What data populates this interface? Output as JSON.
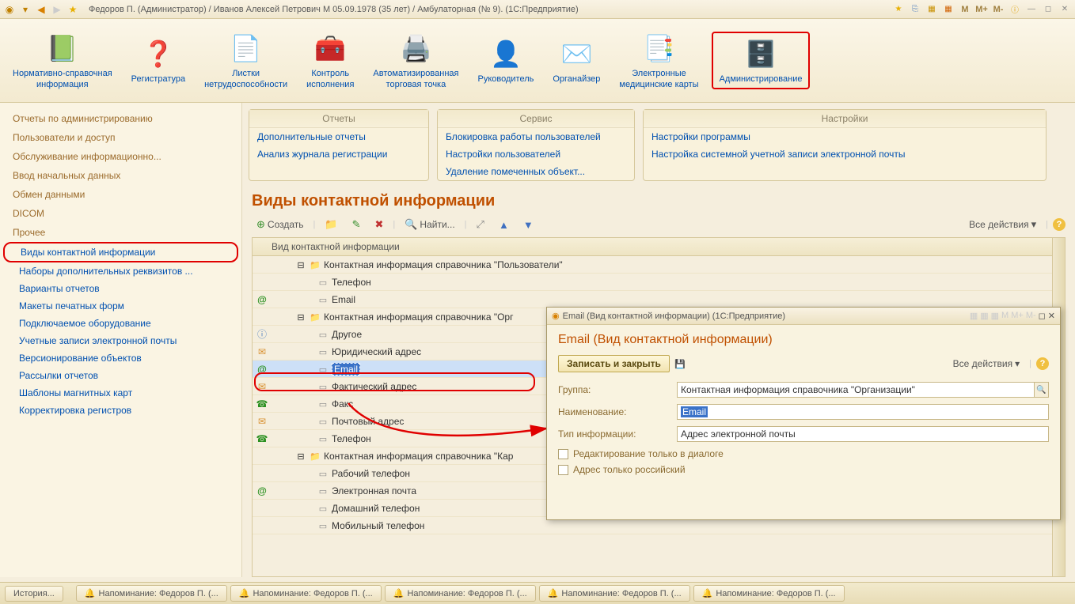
{
  "window": {
    "title": "Федоров П. (Администратор) / Иванов Алексей Петрович М 05.09.1978 (35 лет) / Амбулаторная (№ 9).  (1С:Предприятие)"
  },
  "title_btns": {
    "m": "M",
    "mplus": "M+",
    "mminus": "M-"
  },
  "toolbar": [
    {
      "label": "Нормативно-справочная\nинформация",
      "icon": "📗"
    },
    {
      "label": "Регистратура",
      "icon": "❓"
    },
    {
      "label": "Листки\nнетрудоспособности",
      "icon": "📄"
    },
    {
      "label": "Контроль\nисполнения",
      "icon": "🧰"
    },
    {
      "label": "Автоматизированная\nторговая точка",
      "icon": "🖨️"
    },
    {
      "label": "Руководитель",
      "icon": "👤"
    },
    {
      "label": "Органайзер",
      "icon": "✉️"
    },
    {
      "label": "Электронные\nмедицинские карты",
      "icon": "📑"
    },
    {
      "label": "Администрирование",
      "icon": "🗄️",
      "highlighted": true
    }
  ],
  "sidebar_groups": [
    "Отчеты по администрированию",
    "Пользователи и доступ",
    "Обслуживание информационно...",
    "Ввод начальных данных",
    "Обмен данными",
    "DICOM",
    "Прочее"
  ],
  "sidebar_subs": [
    {
      "label": "Виды контактной информации",
      "highlighted": true
    },
    {
      "label": "Наборы дополнительных реквизитов ..."
    },
    {
      "label": "Варианты отчетов"
    },
    {
      "label": "Макеты печатных форм"
    },
    {
      "label": "Подключаемое оборудование"
    },
    {
      "label": "Учетные записи электронной почты"
    },
    {
      "label": "Версионирование объектов"
    },
    {
      "label": "Рассылки отчетов"
    },
    {
      "label": "Шаблоны магнитных карт"
    },
    {
      "label": "Корректировка регистров"
    }
  ],
  "panels": {
    "reports": {
      "title": "Отчеты",
      "links": [
        "Дополнительные отчеты",
        "Анализ журнала регистрации"
      ]
    },
    "service": {
      "title": "Сервис",
      "links": [
        "Блокировка работы пользователей",
        "Настройки пользователей",
        "Удаление помеченных объект..."
      ]
    },
    "settings": {
      "title": "Настройки",
      "links": [
        "Настройки программы",
        "Настройка системной учетной записи электронной почты"
      ]
    }
  },
  "page": {
    "title": "Виды контактной информации",
    "create": "Создать",
    "find": "Найти...",
    "all_actions": "Все действия",
    "column_header": "Вид контактной информации"
  },
  "tree": [
    {
      "type": "group",
      "label": "Контактная информация справочника \"Пользователи\""
    },
    {
      "type": "item",
      "icon": "",
      "label": "Телефон"
    },
    {
      "type": "item",
      "icon": "at",
      "label": "Email"
    },
    {
      "type": "group",
      "label": "Контактная информация справочника \"Орг"
    },
    {
      "type": "item",
      "icon": "doc",
      "label": "Другое"
    },
    {
      "type": "item",
      "icon": "mail",
      "label": "Юридический адрес"
    },
    {
      "type": "item",
      "icon": "at",
      "label": "Email",
      "selected": true
    },
    {
      "type": "item",
      "icon": "mail",
      "label": "Фактический адрес"
    },
    {
      "type": "item",
      "icon": "phone",
      "label": "Факс"
    },
    {
      "type": "item",
      "icon": "mail",
      "label": "Почтовый адрес"
    },
    {
      "type": "item",
      "icon": "phone",
      "label": "Телефон"
    },
    {
      "type": "group",
      "label": "Контактная информация справочника \"Кар"
    },
    {
      "type": "item",
      "icon": "",
      "label": "Рабочий телефон"
    },
    {
      "type": "item",
      "icon": "at",
      "label": "Электронная почта"
    },
    {
      "type": "item",
      "icon": "",
      "label": "Домашний телефон"
    },
    {
      "type": "item",
      "icon": "",
      "label": "Мобильный телефон"
    }
  ],
  "dialog": {
    "window_title": "Email (Вид контактной информации)  (1С:Предприятие)",
    "heading": "Email (Вид контактной информации)",
    "save_close": "Записать и закрыть",
    "all_actions": "Все действия",
    "group_label": "Группа:",
    "group_value": "Контактная информация справочника \"Организации\"",
    "name_label": "Наименование:",
    "name_value": "Email",
    "type_label": "Тип информации:",
    "type_value": "Адрес электронной почты",
    "chk1": "Редактирование только в диалоге",
    "chk2": "Адрес только российский"
  },
  "taskbar": {
    "history": "История...",
    "reminders": [
      "Напоминание: Федоров П. (...",
      "Напоминание: Федоров П. (...",
      "Напоминание: Федоров П. (...",
      "Напоминание: Федоров П. (...",
      "Напоминание: Федоров П. (..."
    ]
  }
}
